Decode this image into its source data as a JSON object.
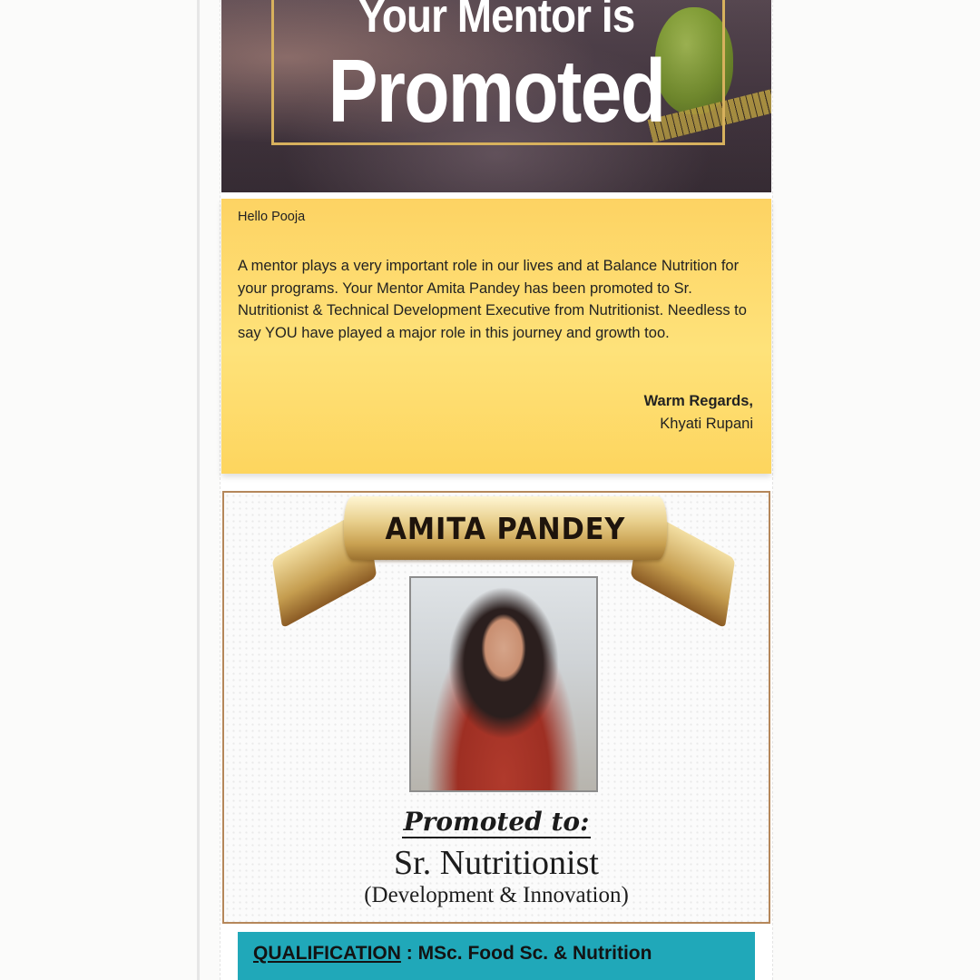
{
  "hero": {
    "title_line1": "Your Mentor is",
    "title_line2": "Promoted"
  },
  "message": {
    "greeting": "Hello Pooja",
    "body": "A mentor plays a very important role in our lives and at Balance Nutrition for your programs. Your Mentor Amita Pandey has been promoted to Sr. Nutritionist & Technical Development Executive from Nutritionist. Needless to say YOU have played a major role in this journey and growth too.",
    "closing": "Warm Regards,",
    "signature": "Khyati Rupani"
  },
  "promotion": {
    "name": "AMITA PANDEY",
    "promoted_label": "Promoted to:",
    "role_title": "Sr. Nutritionist",
    "role_subtitle": "(Development & Innovation)"
  },
  "qualification": {
    "label": "QUALIFICATION",
    "separator": " : ",
    "value": "MSc. Food Sc. & Nutrition"
  },
  "colors": {
    "message_bg": "#fdd860",
    "ribbon_gold": "#d9b86a",
    "qualification_bg": "#20a8b9",
    "frame_gold": "#d7b15d"
  }
}
